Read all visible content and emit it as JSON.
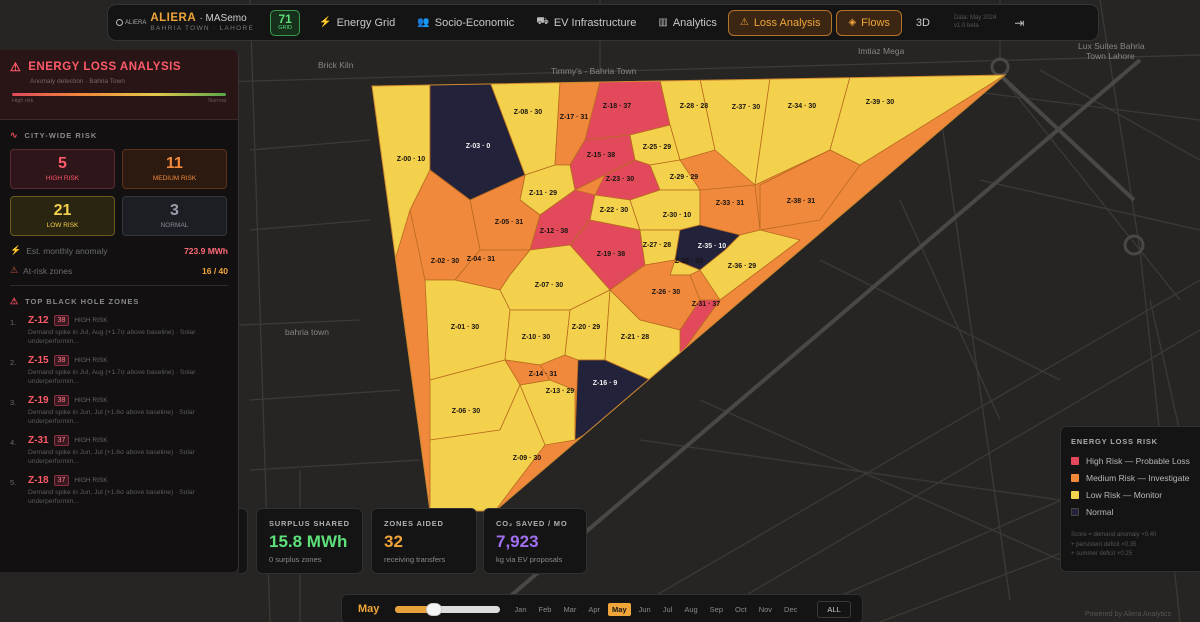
{
  "app": {
    "logo_text": "ALIERA",
    "title": "ALIERA",
    "subtitle": "MASemo",
    "location": "BAHRIA TOWN · LAHORE",
    "score": "71",
    "score_label": "GRID"
  },
  "nav": {
    "tabs": [
      {
        "label": "Energy Grid",
        "icon": "bolt-icon"
      },
      {
        "label": "Socio-Economic",
        "icon": "users-icon"
      },
      {
        "label": "EV Infrastructure",
        "icon": "car-icon"
      },
      {
        "label": "Analytics",
        "icon": "bar-chart-icon"
      },
      {
        "label": "Loss Analysis",
        "icon": "warning-icon",
        "active": true
      }
    ],
    "flows_label": "Flows",
    "view3d_label": "3D",
    "date_line1": "Data: May 2024",
    "date_line2": "v1.0 beta"
  },
  "map_labels": {
    "brick_kiln": "Brick Kiln",
    "timmys": "Timmy's - Bahria Town",
    "imtiaz": "Imtiaz Mega",
    "lux_suites_1": "Lux Suites Bahria",
    "lux_suites_2": "Town Lahore",
    "bahria_town": "bahria town"
  },
  "zones": [
    {
      "id": "Z-00",
      "score": 10,
      "label": "Z-00 · 10",
      "level": "low"
    },
    {
      "id": "Z-01",
      "score": 30,
      "label": "Z-01 · 30",
      "level": "low"
    },
    {
      "id": "Z-02",
      "score": 30,
      "label": "Z-02 · 30",
      "level": "medium"
    },
    {
      "id": "Z-03",
      "score": 0,
      "label": "Z-03 · 0",
      "level": "normal"
    },
    {
      "id": "Z-04",
      "score": 31,
      "label": "Z-04 · 31",
      "level": "medium"
    },
    {
      "id": "Z-05",
      "score": 31,
      "label": "Z-05 · 31",
      "level": "medium"
    },
    {
      "id": "Z-06",
      "score": 30,
      "label": "Z-06 · 30",
      "level": "low"
    },
    {
      "id": "Z-07",
      "score": 30,
      "label": "Z-07 · 30",
      "level": "low"
    },
    {
      "id": "Z-08",
      "score": 30,
      "label": "Z-08 · 30",
      "level": "low"
    },
    {
      "id": "Z-09",
      "score": 30,
      "label": "Z-09 · 30",
      "level": "low"
    },
    {
      "id": "Z-10",
      "score": 30,
      "label": "Z-10 · 30",
      "level": "low"
    },
    {
      "id": "Z-11",
      "score": 29,
      "label": "Z-11 · 29",
      "level": "low"
    },
    {
      "id": "Z-12",
      "score": 38,
      "label": "Z-12 · 38",
      "level": "high"
    },
    {
      "id": "Z-13",
      "score": 29,
      "label": "Z-13 · 29",
      "level": "low"
    },
    {
      "id": "Z-14",
      "score": 31,
      "label": "Z-14 · 31",
      "level": "medium"
    },
    {
      "id": "Z-15",
      "score": 38,
      "label": "Z-15 · 38",
      "level": "high"
    },
    {
      "id": "Z-16",
      "score": 9,
      "label": "Z-16 · 9",
      "level": "normal"
    },
    {
      "id": "Z-17",
      "score": 31,
      "label": "Z-17 · 31",
      "level": "medium"
    },
    {
      "id": "Z-18",
      "score": 37,
      "label": "Z-18 · 37",
      "level": "high"
    },
    {
      "id": "Z-19",
      "score": 38,
      "label": "Z-19 · 38",
      "level": "high"
    },
    {
      "id": "Z-20",
      "score": 29,
      "label": "Z-20 · 29",
      "level": "low"
    },
    {
      "id": "Z-21",
      "score": 28,
      "label": "Z-21 · 28",
      "level": "low"
    },
    {
      "id": "Z-22",
      "score": 30,
      "label": "Z-22 · 30",
      "level": "low"
    },
    {
      "id": "Z-23",
      "score": 30,
      "label": "Z-23 · 30",
      "level": "medium"
    },
    {
      "id": "Z-25",
      "score": 29,
      "label": "Z-25 · 29",
      "level": "low"
    },
    {
      "id": "Z-26",
      "score": 30,
      "label": "Z-26 · 30",
      "level": "medium"
    },
    {
      "id": "Z-27",
      "score": 28,
      "label": "Z-27 · 28",
      "level": "low"
    },
    {
      "id": "Z-28",
      "score": 28,
      "label": "Z-28 · 28",
      "level": "low"
    },
    {
      "id": "Z-29",
      "score": 29,
      "label": "Z-29 · 29",
      "level": "low"
    },
    {
      "id": "Z-30",
      "score": 10,
      "label": "Z-30 · 10",
      "level": "low"
    },
    {
      "id": "Z-31",
      "score": 37,
      "label": "Z-31 · 37",
      "level": "high"
    },
    {
      "id": "Z-32",
      "score": 32,
      "label": "Z-32 · 32",
      "level": "low"
    },
    {
      "id": "Z-33",
      "score": 31,
      "label": "Z-33 · 31",
      "level": "medium"
    },
    {
      "id": "Z-34",
      "score": 30,
      "label": "Z-34 · 30",
      "level": "low"
    },
    {
      "id": "Z-35",
      "score": 10,
      "label": "Z-35 · 10",
      "level": "normal"
    },
    {
      "id": "Z-36",
      "score": 29,
      "label": "Z-36 · 29",
      "level": "low"
    },
    {
      "id": "Z-37",
      "score": 30,
      "label": "Z-37 · 30",
      "level": "low"
    },
    {
      "id": "Z-38",
      "score": 31,
      "label": "Z-38 · 31",
      "level": "medium"
    },
    {
      "id": "Z-39",
      "score": 30,
      "label": "Z-39 · 30",
      "level": "low"
    }
  ],
  "left_panel": {
    "title": "ENERGY LOSS ANALYSIS",
    "subtitle": "Anomaly detection · Bahria Town",
    "gradient_low": "High risk",
    "gradient_high": "Normal",
    "city_risk_title": "CITY-WIDE RISK",
    "risk_cards": [
      {
        "count": "5",
        "label": "HIGH RISK"
      },
      {
        "count": "11",
        "label": "MEDIUM RISK"
      },
      {
        "count": "21",
        "label": "LOW RISK"
      },
      {
        "count": "3",
        "label": "NORMAL"
      }
    ],
    "monthly_anomaly_label": "Est. monthly anomaly",
    "monthly_anomaly_value": "723.9 MWh",
    "at_risk_label": "At-risk zones",
    "at_risk_value": "16 / 40",
    "top_zones_title": "TOP BLACK HOLE ZONES",
    "top_zones": [
      {
        "rank": "1.",
        "zone": "Z-12",
        "score": "38",
        "level": "HIGH RISK",
        "desc": "Demand spike in Jul, Aug (+1.7σ above baseline) · Solar underperformin..."
      },
      {
        "rank": "2.",
        "zone": "Z-15",
        "score": "38",
        "level": "HIGH RISK",
        "desc": "Demand spike in Jul, Aug (+1.7σ above baseline) · Solar underperformin..."
      },
      {
        "rank": "3.",
        "zone": "Z-19",
        "score": "38",
        "level": "HIGH RISK",
        "desc": "Demand spike in Jun, Jul (+1.6σ above baseline) · Solar underperformin..."
      },
      {
        "rank": "4.",
        "zone": "Z-31",
        "score": "37",
        "level": "HIGH RISK",
        "desc": "Demand spike in Jun, Jul (+1.6σ above baseline) · Solar underperformin..."
      },
      {
        "rank": "5.",
        "zone": "Z-18",
        "score": "37",
        "level": "HIGH RISK",
        "desc": "Demand spike in Jun, Jul (+1.6σ above baseline) · Solar underperformin..."
      }
    ]
  },
  "stat_cards": [
    {
      "label": "SURPLUS SHARED",
      "value": "15.8 MWh",
      "sub": "0 surplus zones",
      "color": "#5de07a"
    },
    {
      "label": "ZONES AIDED",
      "value": "32",
      "sub": "receiving transfers",
      "color": "#f0a53a"
    },
    {
      "label": "CO₂ SAVED / MO",
      "value": "7,923",
      "sub": "kg via EV proposals",
      "color": "#a070f0"
    }
  ],
  "legend": {
    "title": "ENERGY LOSS RISK",
    "items": [
      {
        "label": "High Risk — Probable Loss",
        "color": "#e24a5c"
      },
      {
        "label": "Medium Risk — Investigate",
        "color": "#f0893c"
      },
      {
        "label": "Low Risk — Monitor",
        "color": "#f3d14c"
      },
      {
        "label": "Normal",
        "color": "#22223a"
      }
    ],
    "note1": "Score = demand anomaly ×0.40",
    "note2": "+ persistent deficit ×0.35",
    "note3": "+ summer deficit ×0.25"
  },
  "timeline": {
    "current": "May",
    "months": [
      "Jan",
      "Feb",
      "Mar",
      "Apr",
      "May",
      "Jun",
      "Jul",
      "Aug",
      "Sep",
      "Oct",
      "Nov",
      "Dec"
    ],
    "selected_index": 4,
    "all_label": "ALL"
  },
  "footer": {
    "powered": "Powered by Aliera Analytics"
  },
  "colors": {
    "high": "#e24a5c",
    "medium": "#f0893c",
    "low": "#f3d14c",
    "normal": "#22223a",
    "accent": "#f0a53a"
  }
}
